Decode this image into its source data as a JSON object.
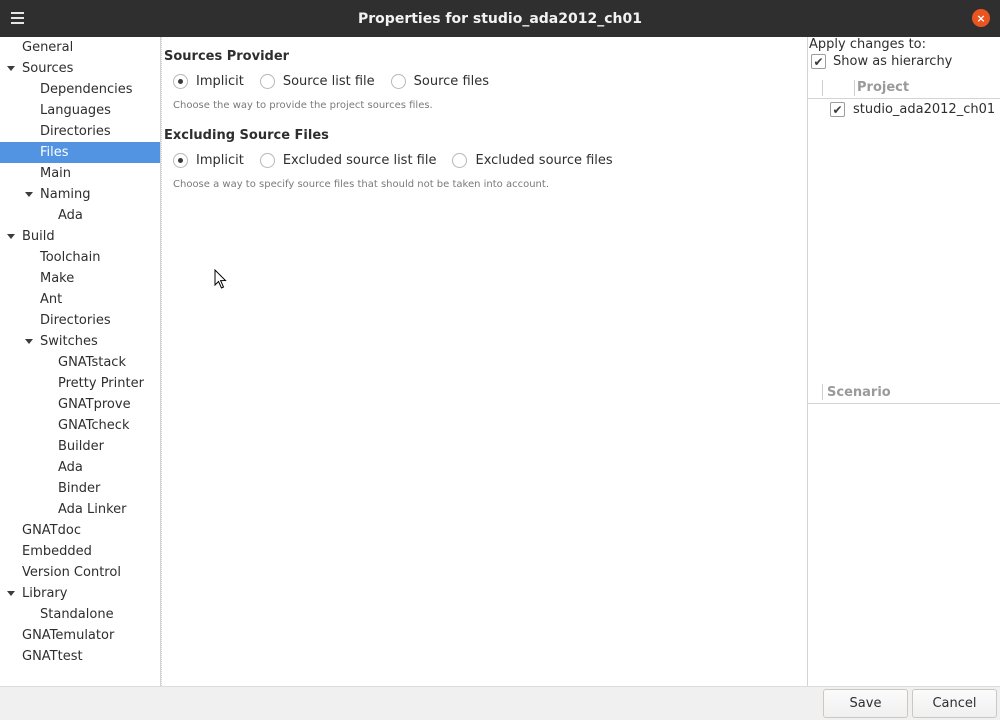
{
  "window": {
    "title": "Properties for studio_ada2012_ch01",
    "menu_icon": "hamburger-menu-icon",
    "close_icon": "close-icon",
    "close_symbol": "×",
    "accent_color": "#e95420"
  },
  "tree": {
    "selected_color": "#5294e2",
    "items": [
      {
        "label": "General",
        "level": 0,
        "expanded": false,
        "selected": false
      },
      {
        "label": "Sources",
        "level": 0,
        "expanded": true,
        "selected": false
      },
      {
        "label": "Dependencies",
        "level": 1,
        "expanded": false,
        "selected": false
      },
      {
        "label": "Languages",
        "level": 1,
        "expanded": false,
        "selected": false
      },
      {
        "label": "Directories",
        "level": 1,
        "expanded": false,
        "selected": false
      },
      {
        "label": "Files",
        "level": 1,
        "expanded": false,
        "selected": true
      },
      {
        "label": "Main",
        "level": 1,
        "expanded": false,
        "selected": false
      },
      {
        "label": "Naming",
        "level": 1,
        "expanded": true,
        "selected": false
      },
      {
        "label": "Ada",
        "level": 2,
        "expanded": false,
        "selected": false
      },
      {
        "label": "Build",
        "level": 0,
        "expanded": true,
        "selected": false
      },
      {
        "label": "Toolchain",
        "level": 1,
        "expanded": false,
        "selected": false
      },
      {
        "label": "Make",
        "level": 1,
        "expanded": false,
        "selected": false
      },
      {
        "label": "Ant",
        "level": 1,
        "expanded": false,
        "selected": false
      },
      {
        "label": "Directories",
        "level": 1,
        "expanded": false,
        "selected": false
      },
      {
        "label": "Switches",
        "level": 1,
        "expanded": true,
        "selected": false
      },
      {
        "label": "GNATstack",
        "level": 2,
        "expanded": false,
        "selected": false
      },
      {
        "label": "Pretty Printer",
        "level": 2,
        "expanded": false,
        "selected": false
      },
      {
        "label": "GNATprove",
        "level": 2,
        "expanded": false,
        "selected": false
      },
      {
        "label": "GNATcheck",
        "level": 2,
        "expanded": false,
        "selected": false
      },
      {
        "label": "Builder",
        "level": 2,
        "expanded": false,
        "selected": false
      },
      {
        "label": "Ada",
        "level": 2,
        "expanded": false,
        "selected": false
      },
      {
        "label": "Binder",
        "level": 2,
        "expanded": false,
        "selected": false
      },
      {
        "label": "Ada Linker",
        "level": 2,
        "expanded": false,
        "selected": false
      },
      {
        "label": "GNATdoc",
        "level": 0,
        "expanded": false,
        "selected": false
      },
      {
        "label": "Embedded",
        "level": 0,
        "expanded": false,
        "selected": false
      },
      {
        "label": "Version Control",
        "level": 0,
        "expanded": false,
        "selected": false
      },
      {
        "label": "Library",
        "level": 0,
        "expanded": true,
        "selected": false
      },
      {
        "label": "Standalone",
        "level": 1,
        "expanded": false,
        "selected": false
      },
      {
        "label": "GNATemulator",
        "level": 0,
        "expanded": false,
        "selected": false
      },
      {
        "label": "GNATtest",
        "level": 0,
        "expanded": false,
        "selected": false
      }
    ]
  },
  "main": {
    "sources_provider": {
      "title": "Sources Provider",
      "options": [
        "Implicit",
        "Source list file",
        "Source files"
      ],
      "selected": 0,
      "hint": "Choose the way to provide the project sources files."
    },
    "excluding": {
      "title": "Excluding Source Files",
      "options": [
        "Implicit",
        "Excluded source list file",
        "Excluded source files"
      ],
      "selected": 0,
      "hint": "Choose a way to specify source files that should not be taken into account."
    }
  },
  "right": {
    "apply_label": "Apply changes to:",
    "show_hierarchy_label": "Show as hierarchy",
    "show_hierarchy_checked": true,
    "project_header": "Project",
    "project_item": "studio_ada2012_ch01",
    "project_checked": true,
    "scenario_header": "Scenario",
    "check_symbol": "✔"
  },
  "buttons": {
    "save": "Save",
    "cancel": "Cancel"
  },
  "cursor_icon": "mouse-pointer-icon"
}
